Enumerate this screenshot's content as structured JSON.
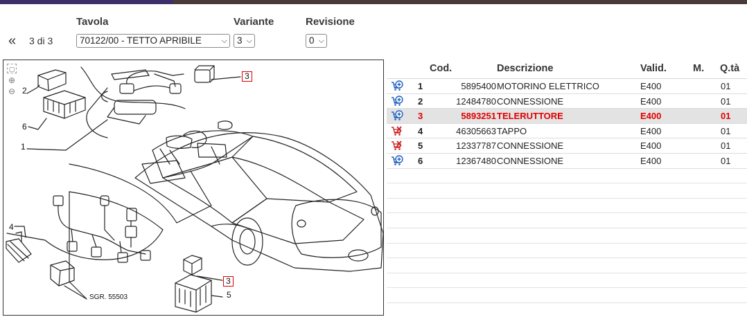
{
  "header": {
    "tavola_label": "Tavola",
    "variante_label": "Variante",
    "revisione_label": "Revisione",
    "prev_icon": "«",
    "page_count": "3 di 3",
    "tavola_value": "70122/00 - TETTO APRIBILE",
    "variante_value": "3",
    "revisione_value": "0"
  },
  "diagram": {
    "sgr_label": "SGR. 55503",
    "callouts": [
      "1",
      "2",
      "3",
      "4",
      "5",
      "6"
    ],
    "highlighted_callout": "3"
  },
  "table": {
    "columns": {
      "cod": "Cod.",
      "descrizione": "Descrizione",
      "valid": "Valid.",
      "m": "M.",
      "qta": "Q.tà"
    },
    "rows": [
      {
        "num": "1",
        "cod": "5895400",
        "desc": "MOTORINO ELETTRICO",
        "valid": "E400",
        "qta": "01",
        "cart": "add-to-cart-icon"
      },
      {
        "num": "2",
        "cod": "12484780",
        "desc": "CONNESSIONE",
        "valid": "E400",
        "qta": "01",
        "cart": "add-to-cart-icon"
      },
      {
        "num": "3",
        "cod": "5893251",
        "desc": "TELERUTTORE",
        "valid": "E400",
        "qta": "01",
        "cart": "add-to-cart-icon",
        "highlight": true
      },
      {
        "num": "4",
        "cod": "46305663",
        "desc": "TAPPO",
        "valid": "E400",
        "qta": "01",
        "cart": "cart-unavailable-icon"
      },
      {
        "num": "5",
        "cod": "12337787",
        "desc": "CONNESSIONE",
        "valid": "E400",
        "qta": "01",
        "cart": "cart-unavailable-icon"
      },
      {
        "num": "6",
        "cod": "12367480",
        "desc": "CONNESSIONE",
        "valid": "E400",
        "qta": "01",
        "cart": "add-to-cart-icon"
      }
    ]
  },
  "colors": {
    "highlight_text": "#e00000",
    "highlight_row_bg": "#e3e3e3",
    "cart_blue": "#1f5fbf",
    "cart_red": "#cc1f1f"
  }
}
